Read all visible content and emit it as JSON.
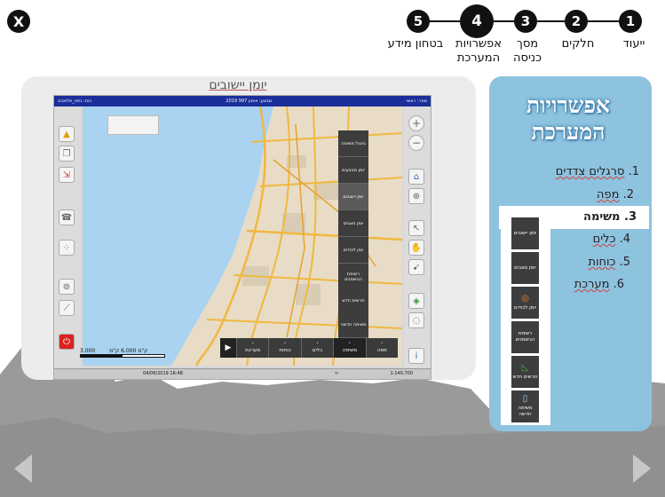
{
  "close": {
    "label": "X"
  },
  "stepper": {
    "steps": [
      {
        "num": "1",
        "label": "ייעוד"
      },
      {
        "num": "2",
        "label": "חלקים"
      },
      {
        "num": "3",
        "label": "מסך כניסה"
      },
      {
        "num": "4",
        "label": "אפשרויות המערכת"
      },
      {
        "num": "5",
        "label": "בטחון מידע"
      }
    ],
    "active": "4"
  },
  "screen": {
    "title": "יומן יישובים",
    "app": {
      "topbar_right": "מפר: ראשי",
      "topbar_center": "מבצע: אימון 997 2019",
      "topbar_left": "כוח: נתח_תלאביב",
      "status_date": "04/06/2019 16:48",
      "status_scale": "1:140,700",
      "status_unit": "יד",
      "scale_left": "3.000 ק\"מ",
      "scale_right": "6.000 ק\"מ",
      "float_menu": [
        {
          "label": "ביטול משימה"
        },
        {
          "label": "יומן מבצעים"
        },
        {
          "label": "יומן יישובים"
        },
        {
          "label": "יומן מצבים"
        },
        {
          "label": "יומן לכודים"
        },
        {
          "label": "רשימת הגישמנים"
        },
        {
          "label": "תרשים חדש"
        },
        {
          "label": "משימה חדשה"
        }
      ],
      "bottom_bar": [
        {
          "label": "מפה"
        },
        {
          "label": "משימה"
        },
        {
          "label": "כלים"
        },
        {
          "label": "כוחות"
        },
        {
          "label": "מערכת"
        }
      ]
    }
  },
  "panel": {
    "title": "אפשרויות המערכת",
    "items": [
      {
        "num": "1.",
        "label": "סרגלים צדדים"
      },
      {
        "num": "2.",
        "label": "מפה"
      },
      {
        "num": "3.",
        "label": "משימה"
      },
      {
        "num": "4.",
        "label": "כלים"
      },
      {
        "num": "5.",
        "label": "כוחות"
      },
      {
        "num": "6.",
        "label": "מערכת"
      }
    ],
    "active_index": 2,
    "inset_buttons": [
      {
        "label": "יומן יישובים",
        "icon": "book-icon"
      },
      {
        "label": "יומן מצבים",
        "icon": "book-icon"
      },
      {
        "label": "יומן לכודים",
        "icon": "lifebuoy-icon"
      },
      {
        "label": "רשימת הגישמנים",
        "icon": "list-icon"
      },
      {
        "label": "תרשים חדש",
        "icon": "triangle-icon"
      },
      {
        "label": "משימה חדשה",
        "icon": "doc-icon"
      }
    ]
  },
  "nav": {
    "prev": "previous",
    "next": "next"
  },
  "colors": {
    "accent_blue": "#8ec3e0",
    "dark_button": "#3d3d3d",
    "app_topbar": "#1b2e9a"
  }
}
